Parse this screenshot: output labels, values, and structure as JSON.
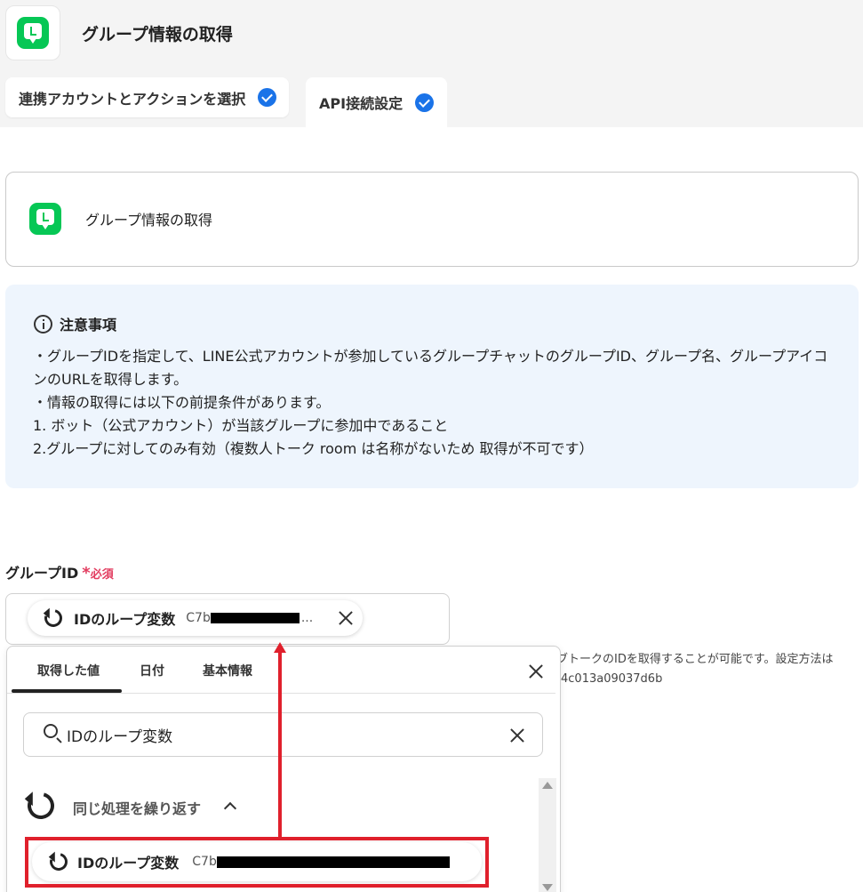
{
  "header": {
    "title": "グループ情報の取得",
    "tabs": [
      {
        "label": "連携アカウントとアクションを選択"
      },
      {
        "label": "API接続設定"
      }
    ]
  },
  "action_card": {
    "title": "グループ情報の取得"
  },
  "notice": {
    "title": "注意事項",
    "lines": [
      "・グループIDを指定して、LINE公式アカウントが参加しているグループチャットのグループID、グループ名、グループアイコンのURLを取得します。",
      "・情報の取得には以下の前提条件があります。",
      "1. ボット（公式アカウント）が当該グループに参加中であること",
      "2.グループに対してのみ有効（複数人トーク room は名称がないため 取得が不可です）"
    ]
  },
  "field": {
    "label": "グループID",
    "required_mark": "*",
    "required_text": "必須",
    "chip": {
      "label": "IDのループ変数",
      "value_prefix": "C7b",
      "ellipsis": "..."
    },
    "help_line1": "ブトークのIDを取得することが可能です。設定方法は",
    "help_line2": "4c013a09037d6b"
  },
  "dropdown": {
    "tabs": [
      "取得した値",
      "日付",
      "基本情報"
    ],
    "active_tab": 0,
    "search_value": "IDのループ変数",
    "group": {
      "label": "同じ処理を繰り返す"
    },
    "item": {
      "label": "IDのループ変数",
      "value_prefix": "C7b"
    }
  },
  "colors": {
    "accent": "#1a73e8",
    "line_green": "#06c755",
    "required": "#e23c5f",
    "annotation_red": "#e0202c",
    "notice_bg": "#eef5fd"
  }
}
